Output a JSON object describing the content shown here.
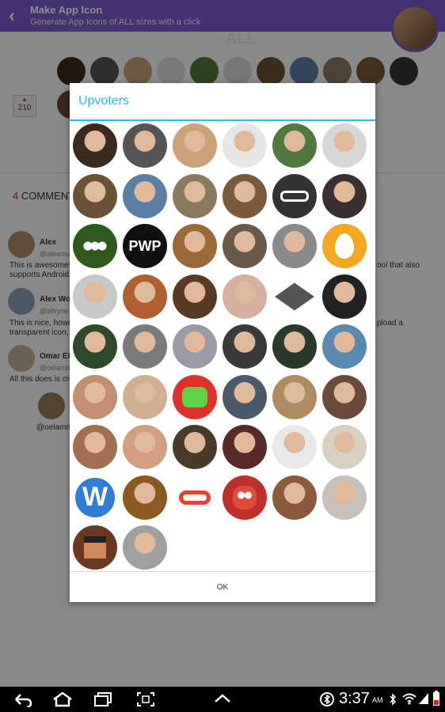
{
  "appbar": {
    "title": "Make App Icon",
    "subtitle": "Generate App Icons of ALL sizes with a click"
  },
  "background": {
    "ghost_heading": "ALL",
    "upvote_count": "210",
    "comments_count": "4",
    "comments_label": "COMMENT",
    "comments": [
      {
        "name": "Alex",
        "handle": "@alexmu",
        "text": "This is awesome!",
        "text2": "supports Android"
      },
      {
        "name": "Alex Wol",
        "handle": "@altryne",
        "text": "This is nice, howe",
        "text2": "transparent icon,"
      },
      {
        "name": "Omar El",
        "handle": "@oelamri",
        "text": "All this does is cro",
        "text2": ""
      }
    ],
    "reply_handle": "@oelamri",
    "right_fragments": [
      "ool that also",
      "pload a"
    ]
  },
  "dialog": {
    "title": "Upvoters",
    "ok_label": "OK",
    "avatars": [
      {
        "icon": "avatar-photo",
        "color": "#3b2a1e"
      },
      {
        "icon": "avatar-photo",
        "color": "#555555"
      },
      {
        "icon": "avatar-photo",
        "color": "#c9a27a"
      },
      {
        "icon": "avatar-photo",
        "color": "#e6e6e6"
      },
      {
        "icon": "avatar-photo",
        "color": "#4f7a3c"
      },
      {
        "icon": "avatar-photo",
        "color": "#d7d7d7"
      },
      {
        "icon": "avatar-photo",
        "color": "#6b5236"
      },
      {
        "icon": "avatar-photo",
        "color": "#5b7fa6"
      },
      {
        "icon": "avatar-photo",
        "color": "#8a7a60"
      },
      {
        "icon": "avatar-photo",
        "color": "#7a5a3a"
      },
      {
        "icon": "glasses-logo",
        "color": "#333333"
      },
      {
        "icon": "avatar-photo",
        "color": "#3a3030"
      },
      {
        "icon": "white-flowers",
        "color": "#2f5a1e"
      },
      {
        "icon": "pwp-logo",
        "color": "#111111",
        "text": "PWP"
      },
      {
        "icon": "avatar-photo",
        "color": "#9a6a3a"
      },
      {
        "icon": "avatar-photo",
        "color": "#6a5a4a"
      },
      {
        "icon": "avatar-photo",
        "color": "#8a8a8a"
      },
      {
        "icon": "egg-logo",
        "color": "#f5a623"
      },
      {
        "icon": "avatar-photo",
        "color": "#c8c8c8"
      },
      {
        "icon": "avatar-photo",
        "color": "#b06030"
      },
      {
        "icon": "avatar-photo",
        "color": "#5a3a22"
      },
      {
        "icon": "avatar-photo",
        "color": "#d8b0a0"
      },
      {
        "icon": "gray-cube",
        "color": "#ffffff"
      },
      {
        "icon": "avatar-photo",
        "color": "#222222"
      },
      {
        "icon": "avatar-photo",
        "color": "#2e4a2a"
      },
      {
        "icon": "avatar-photo",
        "color": "#7a7a7a"
      },
      {
        "icon": "avatar-photo",
        "color": "#9a9aa8"
      },
      {
        "icon": "avatar-photo",
        "color": "#3a3a3a"
      },
      {
        "icon": "avatar-photo",
        "color": "#2a3a2a"
      },
      {
        "icon": "avatar-photo",
        "color": "#5a8ab0"
      },
      {
        "icon": "avatar-photo",
        "color": "#c09070"
      },
      {
        "icon": "avatar-photo",
        "color": "#d0b090"
      },
      {
        "icon": "green-frog",
        "color": "#e0302a"
      },
      {
        "icon": "avatar-photo",
        "color": "#4a5a6a"
      },
      {
        "icon": "avatar-photo",
        "color": "#b08a60"
      },
      {
        "icon": "avatar-photo",
        "color": "#6a4a3a"
      },
      {
        "icon": "avatar-photo",
        "color": "#a07050"
      },
      {
        "icon": "avatar-photo",
        "color": "#d0a080"
      },
      {
        "icon": "avatar-photo",
        "color": "#4a3a2a"
      },
      {
        "icon": "avatar-photo",
        "color": "#5a2a2a"
      },
      {
        "icon": "avatar-photo",
        "color": "#e8e8e8"
      },
      {
        "icon": "avatar-photo",
        "color": "#d8d0c0"
      },
      {
        "icon": "w-logo",
        "color": "#2f7dd4",
        "text": "W"
      },
      {
        "icon": "avatar-photo",
        "color": "#8a5a20"
      },
      {
        "icon": "binoculars-logo",
        "color": "#ffffff"
      },
      {
        "icon": "red-monster",
        "color": "#c0302a"
      },
      {
        "icon": "avatar-photo",
        "color": "#8a5a3a"
      },
      {
        "icon": "avatar-photo",
        "color": "#c8c0b8"
      },
      {
        "icon": "pixel-face",
        "color": "#6a3a20"
      },
      {
        "icon": "avatar-photo",
        "color": "#a0a0a0"
      }
    ]
  },
  "statusbar": {
    "time": "3:37",
    "ampm": "AM"
  }
}
